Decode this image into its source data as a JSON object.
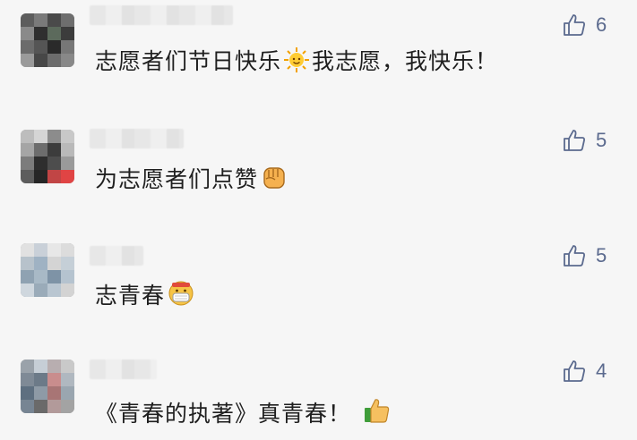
{
  "colors": {
    "background": "#f6f6f6",
    "like_icon": "#5b6a8e",
    "text": "#1f1f1f"
  },
  "comments": [
    {
      "text_before": "志愿者们节日快乐",
      "emoji": "sun-icon",
      "text_after": "我志愿，我快乐！",
      "likes": "6"
    },
    {
      "text_before": "为志愿者们点赞",
      "emoji": "fist-icon",
      "text_after": "",
      "likes": "5"
    },
    {
      "text_before": "志青春",
      "emoji": "mask-face-icon",
      "text_after": "",
      "likes": "5"
    },
    {
      "text_before": "《青春的执著》真青春！",
      "emoji": "thumbs-up-icon",
      "text_after": "",
      "likes": "4"
    }
  ]
}
